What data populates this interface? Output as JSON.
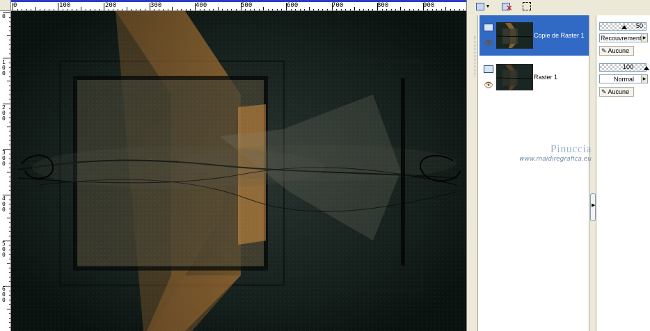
{
  "rulers": {
    "top_labels": [
      "0",
      "100",
      "200",
      "300",
      "400",
      "500",
      "600",
      "700",
      "800",
      "900"
    ],
    "left_labels": [
      "0",
      "100",
      "200",
      "300",
      "400",
      "500",
      "600"
    ]
  },
  "layers": [
    {
      "name": "Copie de Raster 1",
      "selected": true
    },
    {
      "name": "Raster 1",
      "selected": false
    }
  ],
  "properties": [
    {
      "opacity": "50",
      "blend_mode": "Recouvrement",
      "mask": "Aucune"
    },
    {
      "opacity": "100",
      "blend_mode": "Normal",
      "mask": "Aucune"
    }
  ],
  "watermark": {
    "title": "Pinuccia",
    "url": "www.maidiregrafica.eu"
  },
  "colors": {
    "selection": "#316ac5",
    "canvas_bg": "#0d1714",
    "accent_orange": "#c88437",
    "ruler_bar": "#2c3cc8"
  }
}
